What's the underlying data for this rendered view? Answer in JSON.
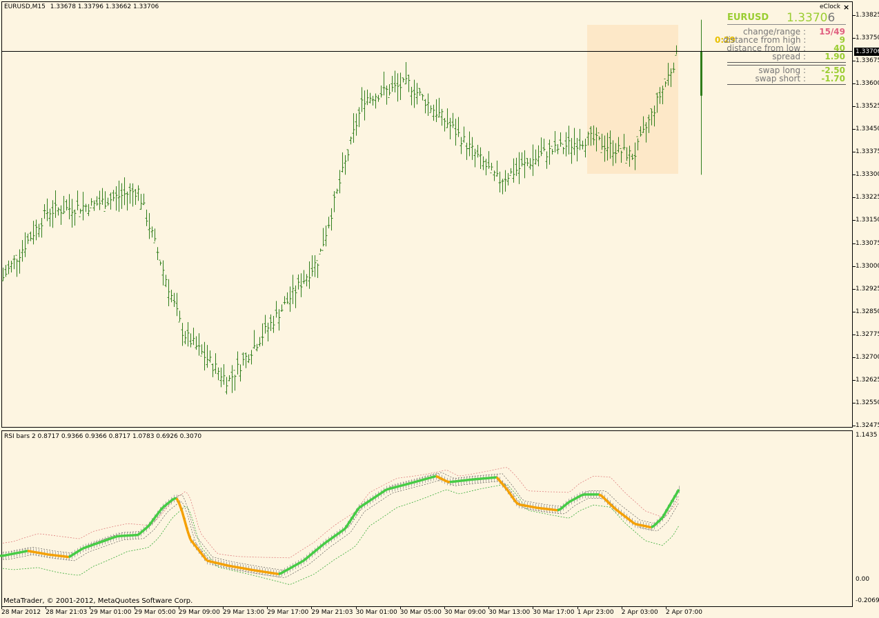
{
  "chart_header": {
    "symbol_timeframe": "EURUSD,M15",
    "ohlc": "1.33678 1.33796 1.33662 1.33706"
  },
  "indicator_header": "RSI bars 2 0.8717 0.9366 0.9366 0.8717 1.0783 0.6926 0.3070",
  "copyright": "MetaTrader, © 2001-2012, MetaQuotes Software Corp.",
  "eclock": {
    "title": "eClock",
    "close_label": "×",
    "symbol": "EURUSD",
    "price_main": "1.3370",
    "price_last_digit": "6",
    "timer": "0:29",
    "rows": [
      {
        "label": "change/range :",
        "value": "15/49",
        "color": "#e06080"
      },
      {
        "label": "distance from high :",
        "value": "9",
        "color": "#9acd32"
      },
      {
        "label": "distance from low :",
        "value": "40",
        "color": "#9acd32"
      },
      {
        "label": "spread :",
        "value": "1.90",
        "color": "#9acd32"
      },
      {
        "label": "swap long :",
        "value": "-2.50",
        "color": "#9acd32"
      },
      {
        "label": "swap short :",
        "value": "-1.70",
        "color": "#9acd32"
      }
    ]
  },
  "current_price_label": "1.33706",
  "price_axis_labels": [
    "1.33825",
    "1.33750",
    "1.33675",
    "1.33600",
    "1.33525",
    "1.33450",
    "1.33375",
    "1.33300",
    "1.33225",
    "1.33150",
    "1.33075",
    "1.33000",
    "1.32925",
    "1.32850",
    "1.32775",
    "1.32700",
    "1.32625",
    "1.32550",
    "1.32475"
  ],
  "sub_axis_labels": {
    "top": "1.1435",
    "zero": "0.00",
    "bottom": "-0.2069"
  },
  "time_axis_labels": [
    "28 Mar 2012",
    "28 Mar 21:03",
    "29 Mar 01:00",
    "29 Mar 05:00",
    "29 Mar 09:00",
    "29 Mar 13:00",
    "29 Mar 17:00",
    "29 Mar 21:03",
    "30 Mar 01:00",
    "30 Mar 05:00",
    "30 Mar 09:00",
    "30 Mar 13:00",
    "30 Mar 17:00",
    "1 Apr 23:00",
    "2 Apr 03:00",
    "2 Apr 07:00"
  ],
  "colors": {
    "background": "#fdf5e1",
    "bar": "#2e7d1a",
    "highlight_box": "#fde8c8",
    "rsi_up": "#44cc44",
    "rsi_down": "#f5a000",
    "band_upper": "#e08080",
    "band_lower": "#33aa33"
  },
  "chart_data": [
    {
      "type": "ohlc_bars",
      "symbol": "EURUSD",
      "timeframe": "M15",
      "ylim": [
        1.32475,
        1.33825
      ],
      "current_price": 1.33706,
      "close_path": [
        {
          "t": "28 Mar 2012",
          "close": 1.3296
        },
        {
          "t": "28 Mar 21:03",
          "close": 1.3318
        },
        {
          "t": "29 Mar 01:00",
          "close": 1.332
        },
        {
          "t": "29 Mar 05:00",
          "close": 1.3325
        },
        {
          "t": "29 Mar 09:00",
          "close": 1.3278
        },
        {
          "t": "29 Mar 13:00",
          "close": 1.3262
        },
        {
          "t": "29 Mar 17:00",
          "close": 1.3282
        },
        {
          "t": "29 Mar 21:03",
          "close": 1.3302
        },
        {
          "t": "30 Mar 01:00",
          "close": 1.3355
        },
        {
          "t": "30 Mar 05:00",
          "close": 1.336
        },
        {
          "t": "30 Mar 09:00",
          "close": 1.3345
        },
        {
          "t": "30 Mar 13:00",
          "close": 1.3328
        },
        {
          "t": "30 Mar 17:00",
          "close": 1.3337
        },
        {
          "t": "1 Apr 23:00",
          "close": 1.3342
        },
        {
          "t": "2 Apr 03:00",
          "close": 1.3336
        },
        {
          "t": "2 Apr 07:00",
          "close": 1.33706
        }
      ]
    },
    {
      "type": "line",
      "name": "RSI bars 2",
      "ylim": [
        -0.2069,
        1.1435
      ],
      "values": [
        0.8717,
        0.9366,
        0.9366,
        0.8717,
        1.0783,
        0.6926,
        0.307
      ]
    }
  ]
}
